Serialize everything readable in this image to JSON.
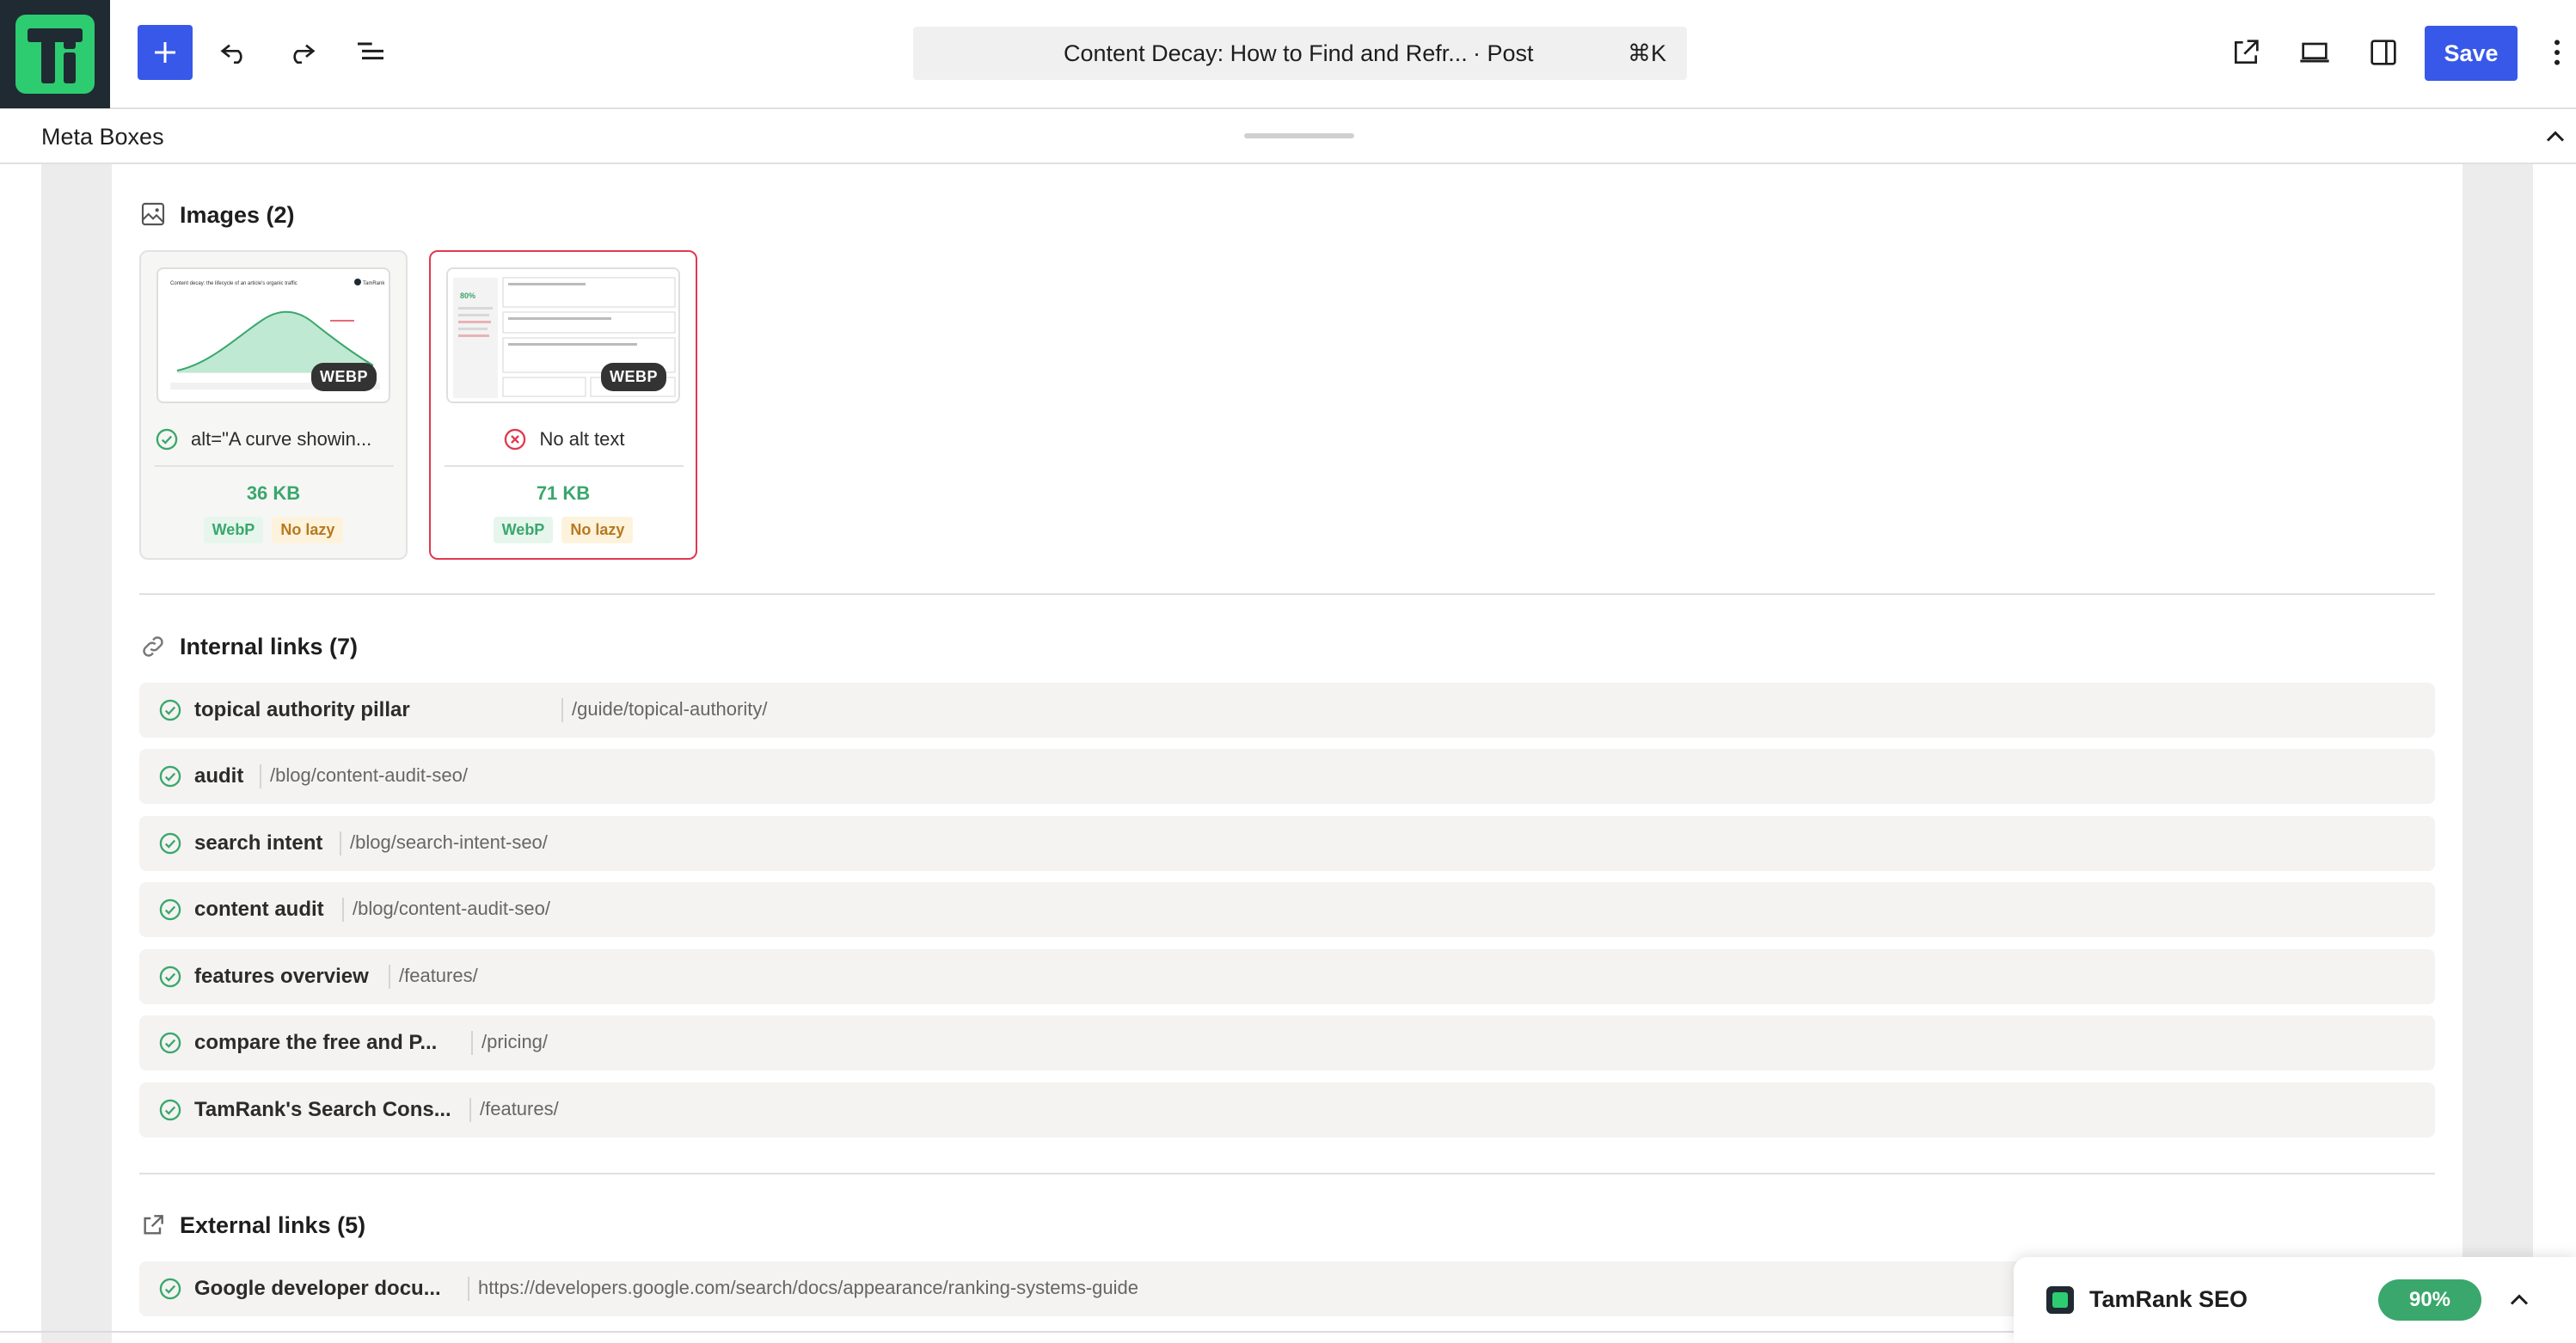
{
  "header": {
    "post_title": "Content Decay: How to Find and Refr...",
    "post_type": "· Post",
    "shortcut": "⌘K",
    "save_label": "Save"
  },
  "meta_boxes": {
    "label": "Meta Boxes"
  },
  "images": {
    "title": "Images (2)",
    "items": [
      {
        "format_badge": "WEBP",
        "alt_text": "alt=\"A curve showin...",
        "alt_ok": true,
        "size": "36 KB",
        "chips": [
          "WebP",
          "No lazy"
        ]
      },
      {
        "format_badge": "WEBP",
        "alt_text": "No alt text",
        "alt_ok": false,
        "size": "71 KB",
        "chips": [
          "WebP",
          "No lazy"
        ]
      }
    ],
    "thumb1": {
      "heading": "Content decay: the lifecycle of an article's organic traffic",
      "brand": "TamRank"
    },
    "thumb2": {
      "score": "80%"
    }
  },
  "internal_links": {
    "title": "Internal links (7)",
    "items": [
      {
        "anchor": "topical authority pillar",
        "url": "/guide/topical-authority/"
      },
      {
        "anchor": "audit",
        "url": "/blog/content-audit-seo/"
      },
      {
        "anchor": "search intent",
        "url": "/blog/search-intent-seo/"
      },
      {
        "anchor": "content audit",
        "url": "/blog/content-audit-seo/"
      },
      {
        "anchor": "features overview",
        "url": "/features/"
      },
      {
        "anchor": "compare the free and P...",
        "url": "/pricing/"
      },
      {
        "anchor": "TamRank's Search Cons...",
        "url": "/features/"
      }
    ]
  },
  "external_links": {
    "title": "External links (5)",
    "items": [
      {
        "anchor": "Google developer docu...",
        "url": "https://developers.google.com/search/docs/appearance/ranking-systems-guide"
      }
    ]
  },
  "seo_widget": {
    "name": "TamRank SEO",
    "score": "90%"
  },
  "colors": {
    "accent": "#3858e9",
    "good": "#3aa76d",
    "bad": "#e0394f",
    "warn": "#b7791f"
  }
}
